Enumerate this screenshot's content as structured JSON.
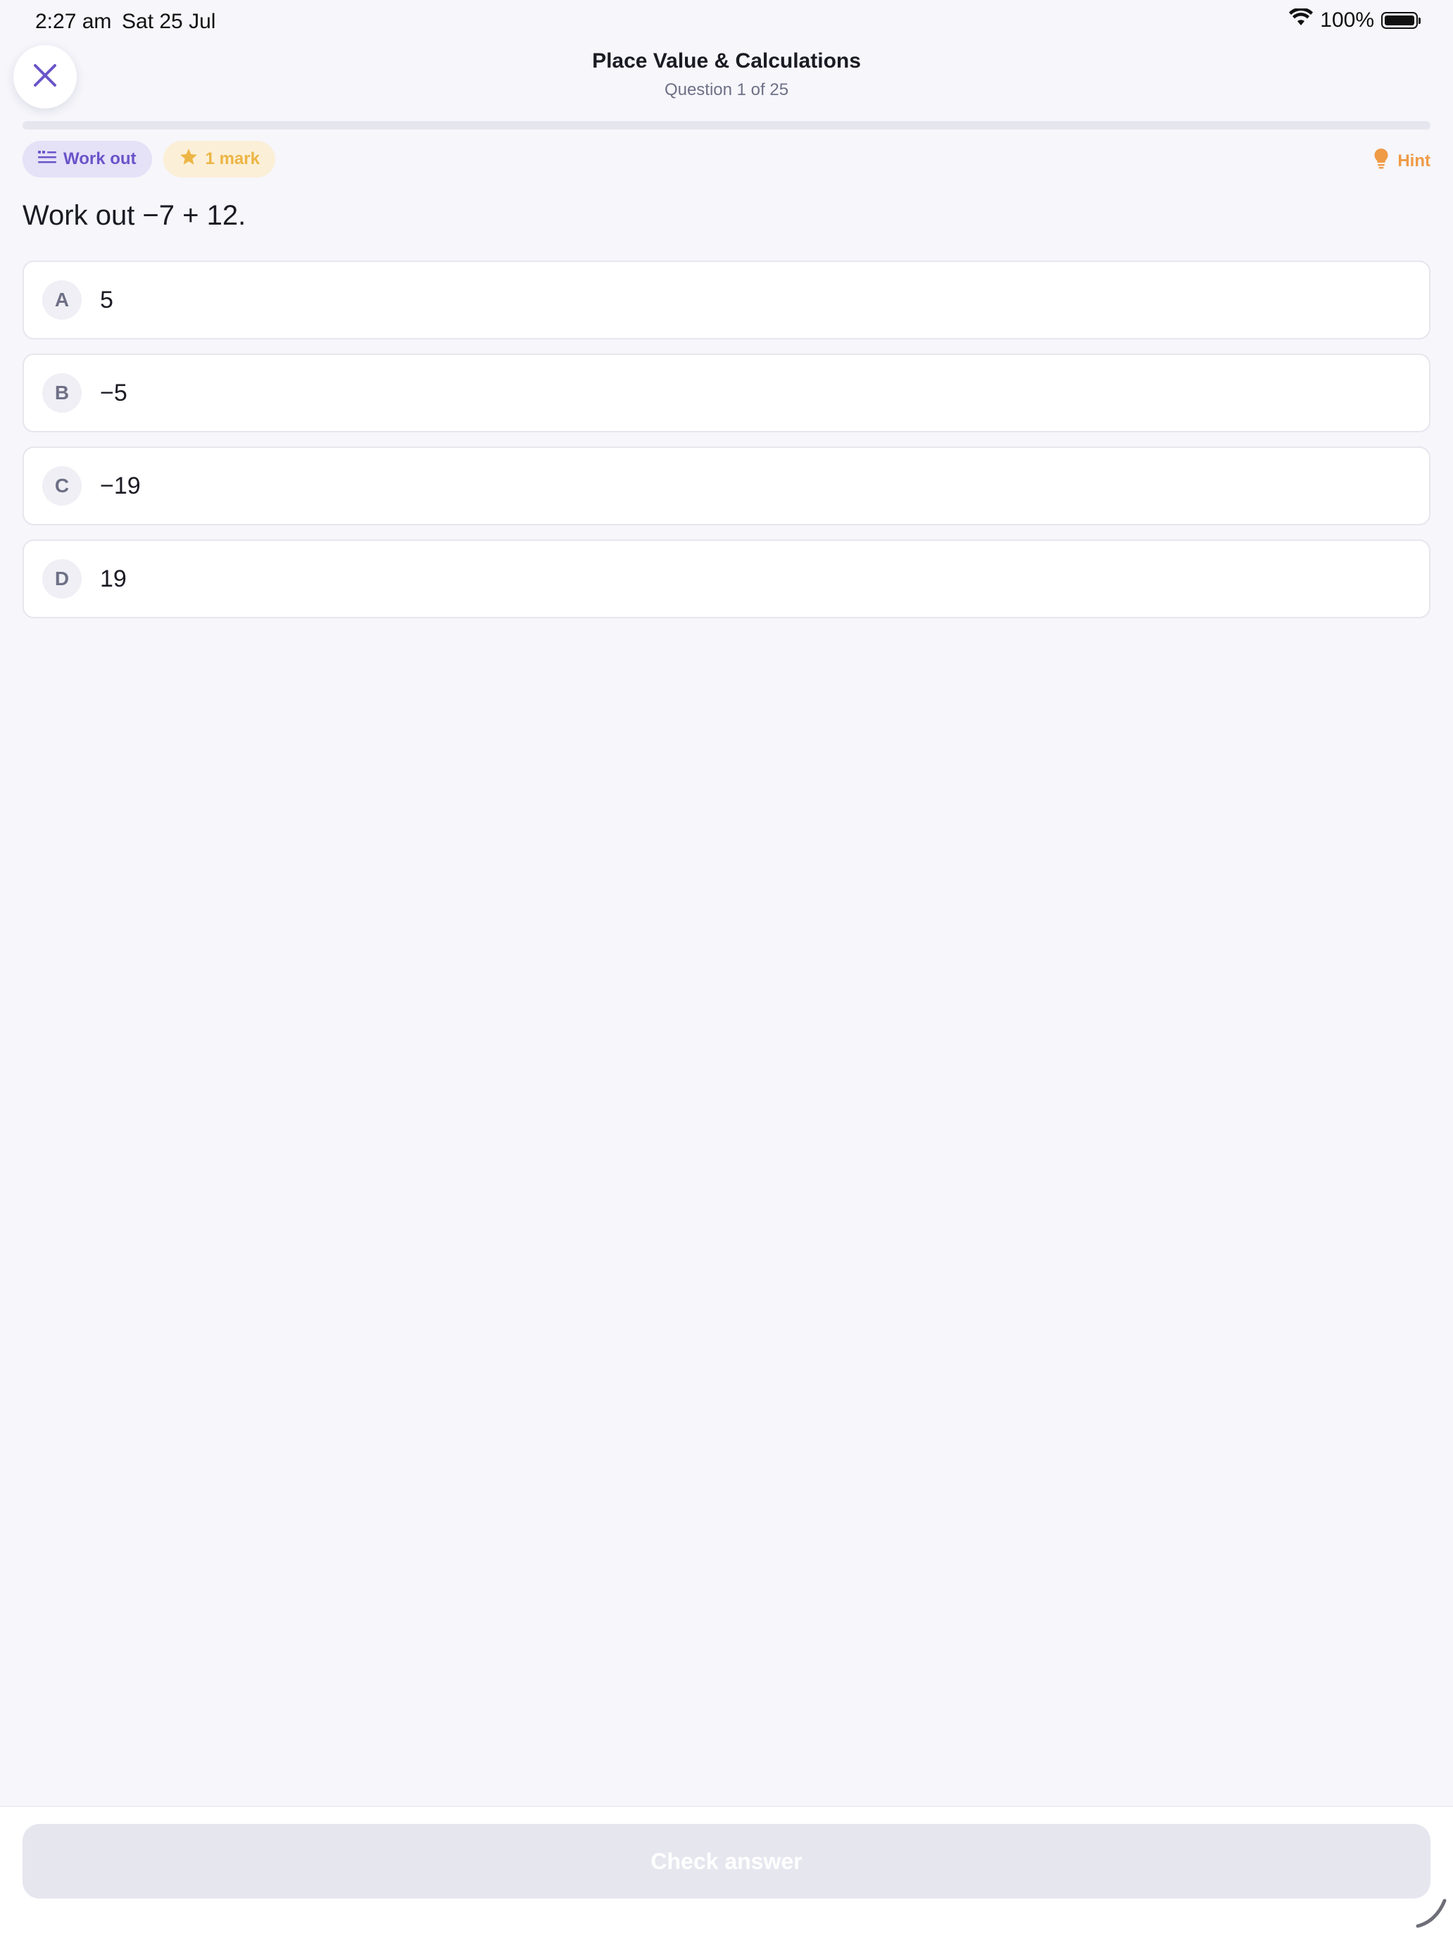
{
  "status_bar": {
    "time": "2:27 am",
    "date": "Sat 25 Jul",
    "battery": "100%"
  },
  "header": {
    "title": "Place Value & Calculations",
    "subtitle": "Question 1 of 25",
    "progress_fraction": 0.0
  },
  "tags": {
    "type_label": "Work out",
    "marks_label": "1 mark"
  },
  "hint_label": "Hint",
  "question": {
    "text": "Work out −7 + 12."
  },
  "options": [
    {
      "letter": "A",
      "text": "5"
    },
    {
      "letter": "B",
      "text": "−5"
    },
    {
      "letter": "C",
      "text": "−19"
    },
    {
      "letter": "D",
      "text": "19"
    }
  ],
  "footer": {
    "check_label": "Check answer"
  },
  "colors": {
    "accent": "#6a54c9",
    "mark": "#ecb544",
    "hint": "#ef9a45",
    "background": "#f6f6fb"
  }
}
